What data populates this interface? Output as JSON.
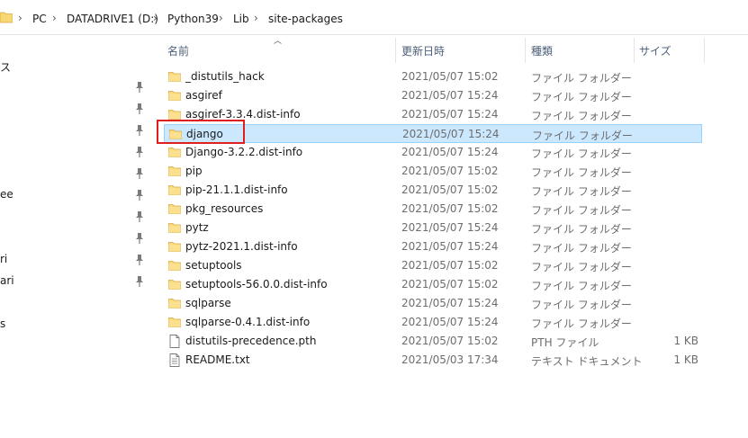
{
  "address": {
    "crumbs": [
      "PC",
      "DATADRIVE1 (D:)",
      "Python39",
      "Lib",
      "site-packages"
    ]
  },
  "nav": {
    "labels": [
      "ス",
      "ee",
      "ri",
      "ari",
      "s"
    ]
  },
  "columns": {
    "name": "名前",
    "date": "更新日時",
    "type": "種類",
    "size": "サイズ"
  },
  "rows": [
    {
      "name": "_distutils_hack",
      "date": "2021/05/07 15:02",
      "type": "ファイル フォルダー",
      "size": "",
      "kind": "folder"
    },
    {
      "name": "asgiref",
      "date": "2021/05/07 15:24",
      "type": "ファイル フォルダー",
      "size": "",
      "kind": "folder"
    },
    {
      "name": "asgiref-3.3.4.dist-info",
      "date": "2021/05/07 15:24",
      "type": "ファイル フォルダー",
      "size": "",
      "kind": "folder"
    },
    {
      "name": "django",
      "date": "2021/05/07 15:24",
      "type": "ファイル フォルダー",
      "size": "",
      "kind": "folder"
    },
    {
      "name": "Django-3.2.2.dist-info",
      "date": "2021/05/07 15:24",
      "type": "ファイル フォルダー",
      "size": "",
      "kind": "folder"
    },
    {
      "name": "pip",
      "date": "2021/05/07 15:02",
      "type": "ファイル フォルダー",
      "size": "",
      "kind": "folder"
    },
    {
      "name": "pip-21.1.1.dist-info",
      "date": "2021/05/07 15:02",
      "type": "ファイル フォルダー",
      "size": "",
      "kind": "folder"
    },
    {
      "name": "pkg_resources",
      "date": "2021/05/07 15:02",
      "type": "ファイル フォルダー",
      "size": "",
      "kind": "folder"
    },
    {
      "name": "pytz",
      "date": "2021/05/07 15:24",
      "type": "ファイル フォルダー",
      "size": "",
      "kind": "folder"
    },
    {
      "name": "pytz-2021.1.dist-info",
      "date": "2021/05/07 15:24",
      "type": "ファイル フォルダー",
      "size": "",
      "kind": "folder"
    },
    {
      "name": "setuptools",
      "date": "2021/05/07 15:02",
      "type": "ファイル フォルダー",
      "size": "",
      "kind": "folder"
    },
    {
      "name": "setuptools-56.0.0.dist-info",
      "date": "2021/05/07 15:02",
      "type": "ファイル フォルダー",
      "size": "",
      "kind": "folder"
    },
    {
      "name": "sqlparse",
      "date": "2021/05/07 15:24",
      "type": "ファイル フォルダー",
      "size": "",
      "kind": "folder"
    },
    {
      "name": "sqlparse-0.4.1.dist-info",
      "date": "2021/05/07 15:24",
      "type": "ファイル フォルダー",
      "size": "",
      "kind": "folder"
    },
    {
      "name": "distutils-precedence.pth",
      "date": "2021/05/07 15:02",
      "type": "PTH ファイル",
      "size": "1 KB",
      "kind": "file"
    },
    {
      "name": "README.txt",
      "date": "2021/05/03 17:34",
      "type": "テキスト ドキュメント",
      "size": "1 KB",
      "kind": "text"
    }
  ],
  "selected_index": 3,
  "colors": {
    "selection": "#cce8ff",
    "highlight": "#e02020",
    "folder": "#f8d775"
  }
}
